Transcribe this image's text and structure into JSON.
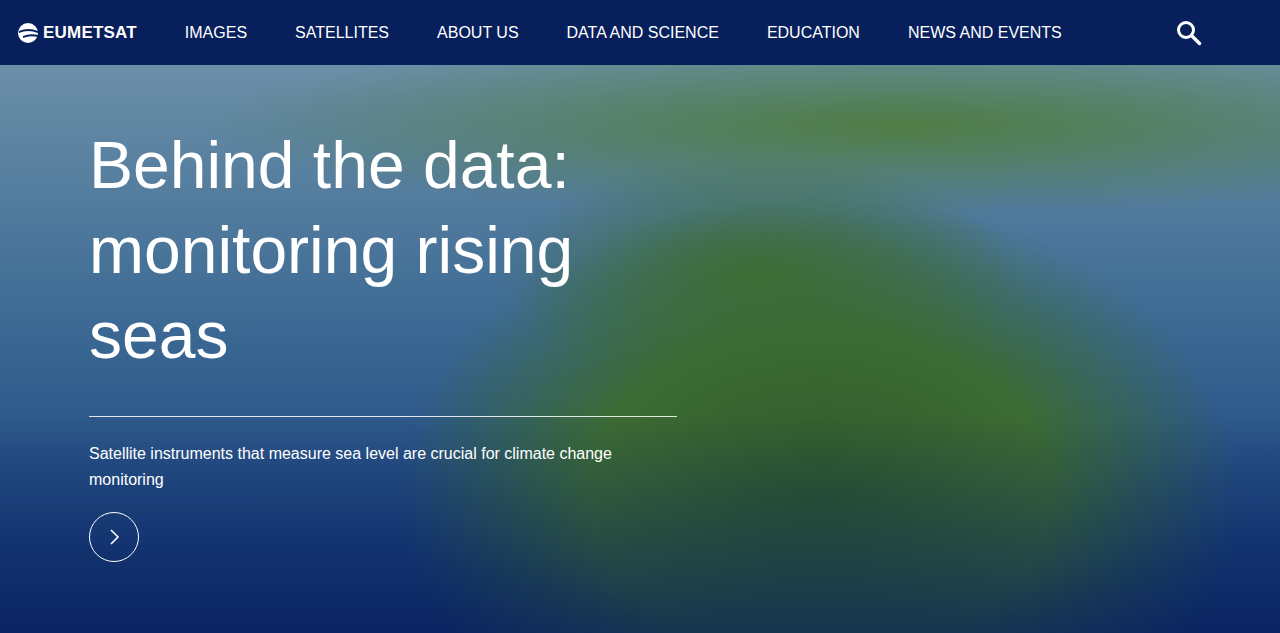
{
  "nav": {
    "logo": "EUMETSAT",
    "items": [
      "IMAGES",
      "SATELLITES",
      "ABOUT US",
      "DATA AND SCIENCE",
      "EDUCATION",
      "NEWS AND EVENTS"
    ]
  },
  "hero": {
    "title": "Behind the data: monitoring rising seas",
    "subtitle": "Satellite instruments that measure sea level are crucial for climate change monitoring"
  }
}
